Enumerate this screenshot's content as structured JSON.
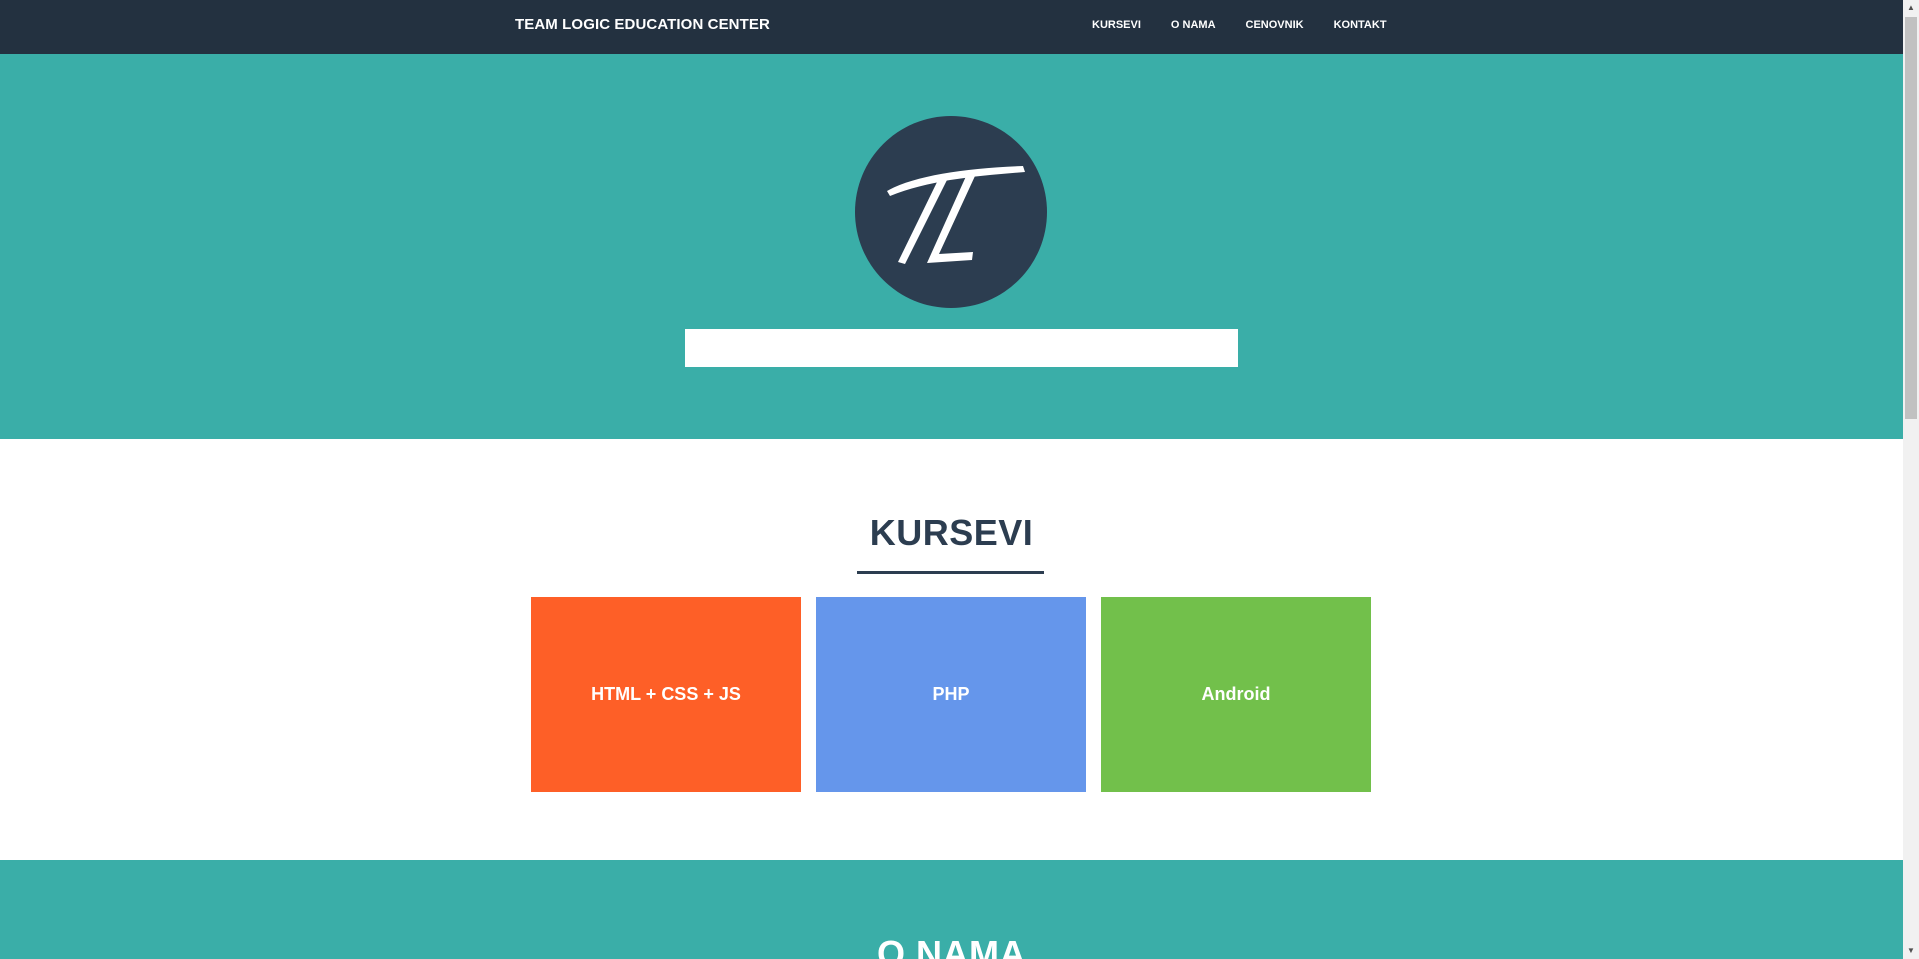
{
  "navbar": {
    "brand": "TEAM LOGIC EDUCATION CENTER",
    "links": [
      "KURSEVI",
      "O NAMA",
      "CENOVNIK",
      "KONTAKT"
    ]
  },
  "hero": {
    "logo_icon": "tl-monogram-logo",
    "logo_text": "TL",
    "input_value": ""
  },
  "kursevi": {
    "heading": "KURSEVI",
    "courses": [
      {
        "label": "HTML + CSS + JS",
        "color": "#fe5f27"
      },
      {
        "label": "PHP",
        "color": "#6596eb"
      },
      {
        "label": "Android",
        "color": "#72c04b"
      }
    ]
  },
  "onama": {
    "heading": "O NAMA"
  },
  "colors": {
    "navbar": "#233140",
    "teal": "#3aaea8",
    "dark": "#2c3d50"
  },
  "scrollbar": {
    "up_icon": "scroll-up-arrow-icon",
    "down_icon": "scroll-down-arrow-icon"
  }
}
